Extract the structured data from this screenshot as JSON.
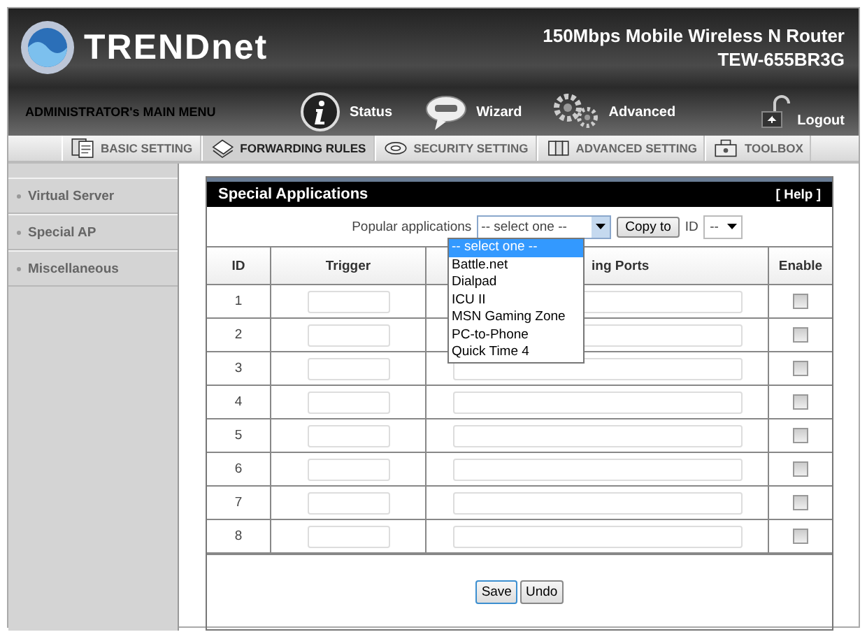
{
  "header": {
    "brand": "TRENDnet",
    "product": "150Mbps Mobile Wireless N Router",
    "model": "TEW-655BR3G",
    "menu_title": "ADMINISTRATOR's MAIN MENU",
    "nav": [
      {
        "label": "Status",
        "kind": "status"
      },
      {
        "label": "Wizard",
        "kind": "wizard"
      },
      {
        "label": "Advanced",
        "kind": "advanced"
      }
    ],
    "logout": "Logout"
  },
  "tabs": [
    {
      "label": "BASIC SETTING",
      "kind": "basic",
      "selected": false
    },
    {
      "label": "FORWARDING RULES",
      "kind": "forwarding",
      "selected": true
    },
    {
      "label": "SECURITY SETTING",
      "kind": "security",
      "selected": false
    },
    {
      "label": "ADVANCED SETTING",
      "kind": "advanced",
      "selected": false
    },
    {
      "label": "TOOLBOX",
      "kind": "toolbox",
      "selected": false
    }
  ],
  "sidebar": [
    "Virtual Server",
    "Special AP",
    "Miscellaneous"
  ],
  "panel": {
    "title": "Special Applications",
    "help": "[ Help ]",
    "popular_label": "Popular applications",
    "select_value": "-- select one --",
    "options": [
      {
        "label": "-- select one --",
        "selected": true
      },
      {
        "label": "Battle.net",
        "selected": false
      },
      {
        "label": "Dialpad",
        "selected": false
      },
      {
        "label": "ICU II",
        "selected": false
      },
      {
        "label": "MSN Gaming Zone",
        "selected": false
      },
      {
        "label": "PC-to-Phone",
        "selected": false
      },
      {
        "label": "Quick Time 4",
        "selected": false
      }
    ],
    "copy_button": "Copy to",
    "id_label": "ID",
    "id_value": "--",
    "columns": [
      "ID",
      "Trigger",
      "ing Ports",
      "Enable"
    ],
    "rows": [
      {
        "id": "1",
        "checked": false
      },
      {
        "id": "2",
        "checked": false
      },
      {
        "id": "3",
        "checked": false
      },
      {
        "id": "4",
        "checked": false
      },
      {
        "id": "5",
        "checked": false
      },
      {
        "id": "6",
        "checked": false
      },
      {
        "id": "7",
        "checked": false
      },
      {
        "id": "8",
        "checked": false
      }
    ],
    "buttons": [
      "Save",
      "Undo"
    ]
  }
}
